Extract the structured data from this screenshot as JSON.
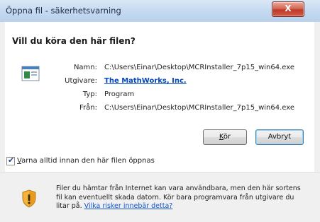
{
  "window": {
    "title": "Öppna fil - säkerhetsvarning",
    "close_glyph": "X"
  },
  "dialog": {
    "question": "Vill du köra den här filen?",
    "file_icon": "executable-file-icon",
    "fields": {
      "name_label": "Namn:",
      "name_value": "C:\\Users\\Einar\\Desktop\\MCRInstaller_7p15_win64.exe",
      "publisher_label": "Utgivare:",
      "publisher_value": "The MathWorks, Inc.",
      "type_label": "Typ:",
      "type_value": "Program",
      "from_label": "Från:",
      "from_value": "C:\\Users\\Einar\\Desktop\\MCRInstaller_7p15_win64.exe"
    },
    "buttons": {
      "run_mnemonic": "K",
      "run_rest": "ör",
      "cancel": "Avbryt"
    },
    "checkbox": {
      "checked": true,
      "mnemonic": "V",
      "label_rest": "arna alltid innan den här filen öppnas"
    },
    "footer": {
      "icon": "shield-warning-icon",
      "text": "Filer du hämtar från Internet kan vara användbara, men den här sortens fil kan eventuellt skada datorn. Kör bara programvara från utgivare du litar på. ",
      "link": "Vilka risker innebär detta?"
    }
  }
}
